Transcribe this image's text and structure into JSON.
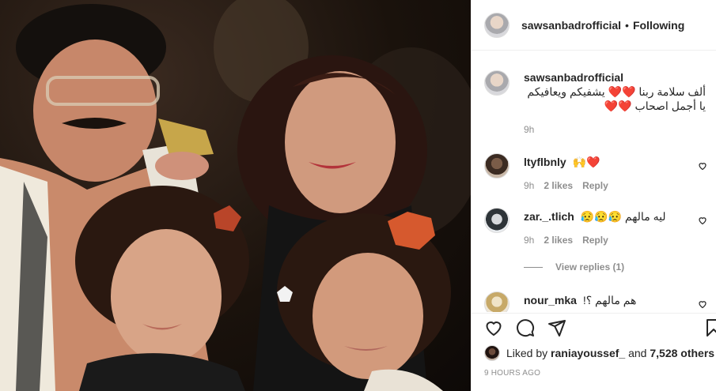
{
  "post_header": {
    "username": "sawsanbadrofficial",
    "separator": "•",
    "follow_status": "Following"
  },
  "caption": {
    "username": "sawsanbadrofficial",
    "text": "ألف سلامة ربنا ❤️❤️ يشفيكم ويعافيكم يا أجمل اصحاب ❤️❤️",
    "time": "9h"
  },
  "comments": [
    {
      "username": "ltyflbnly",
      "text": "🙌❤️",
      "time": "9h",
      "likes": "2 likes",
      "reply": "Reply"
    },
    {
      "username": "zar._.tlich",
      "text": "ليه مالهم 😥😥😥",
      "time": "9h",
      "likes": "2 likes",
      "reply": "Reply",
      "view_replies": "View replies (1)"
    },
    {
      "username": "nour_mka",
      "text": "هم مالهم ؟!"
    }
  ],
  "likes_line": {
    "prefix": "Liked by",
    "user": "raniayoussef_",
    "middle": "and",
    "count": "7,528 others"
  },
  "timestamp": "9 HOURS AGO",
  "icons": {
    "like": "heart-icon",
    "comment": "comment-icon",
    "share": "share-icon",
    "save": "bookmark-icon"
  },
  "colors": {
    "text": "#262626",
    "secondary": "#8e8e8e",
    "border": "#efefef",
    "heart_red": "#ed4956"
  }
}
